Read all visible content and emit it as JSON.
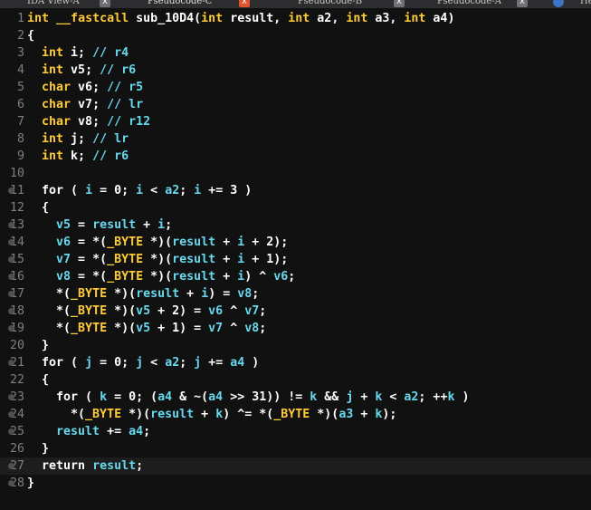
{
  "tabs": [
    {
      "label": "IDA View-A",
      "close": "x",
      "state": "inactive"
    },
    {
      "label": "Pseudocode-C",
      "close": "x",
      "state": "active"
    },
    {
      "label": "Pseudocode-B",
      "close": "x",
      "state": "inactive"
    },
    {
      "label": "Pseudocode-A",
      "close": "x",
      "state": "inactive"
    },
    {
      "label": "He",
      "close": "",
      "state": "inactive"
    }
  ],
  "colors": {
    "background": "#111111",
    "keyword": "#ffcc33",
    "identifier": "#66d9ef",
    "plain": "#ffffff",
    "line_number": "#7f7f7f",
    "tab_close": "#e0522f"
  },
  "code": {
    "current_line": 27,
    "lines": [
      {
        "n": "1",
        "marker": false,
        "tokens": [
          [
            "kw",
            "int"
          ],
          [
            "p",
            " "
          ],
          [
            "kw",
            "__fastcall"
          ],
          [
            "p",
            " sub_10D4("
          ],
          [
            "kw",
            "int"
          ],
          [
            "p",
            " result, "
          ],
          [
            "kw",
            "int"
          ],
          [
            "p",
            " a2, "
          ],
          [
            "kw",
            "int"
          ],
          [
            "p",
            " a3, "
          ],
          [
            "kw",
            "int"
          ],
          [
            "p",
            " a4)"
          ]
        ]
      },
      {
        "n": "2",
        "marker": false,
        "tokens": [
          [
            "p",
            "{"
          ]
        ]
      },
      {
        "n": "3",
        "marker": false,
        "tokens": [
          [
            "p",
            "  "
          ],
          [
            "kw",
            "int"
          ],
          [
            "p",
            " i; "
          ],
          [
            "cm",
            "// r4"
          ]
        ]
      },
      {
        "n": "4",
        "marker": false,
        "tokens": [
          [
            "p",
            "  "
          ],
          [
            "kw",
            "int"
          ],
          [
            "p",
            " v5; "
          ],
          [
            "cm",
            "// r6"
          ]
        ]
      },
      {
        "n": "5",
        "marker": false,
        "tokens": [
          [
            "p",
            "  "
          ],
          [
            "kw",
            "char"
          ],
          [
            "p",
            " v6; "
          ],
          [
            "cm",
            "// r5"
          ]
        ]
      },
      {
        "n": "6",
        "marker": false,
        "tokens": [
          [
            "p",
            "  "
          ],
          [
            "kw",
            "char"
          ],
          [
            "p",
            " v7; "
          ],
          [
            "cm",
            "// lr"
          ]
        ]
      },
      {
        "n": "7",
        "marker": false,
        "tokens": [
          [
            "p",
            "  "
          ],
          [
            "kw",
            "char"
          ],
          [
            "p",
            " v8; "
          ],
          [
            "cm",
            "// r12"
          ]
        ]
      },
      {
        "n": "8",
        "marker": false,
        "tokens": [
          [
            "p",
            "  "
          ],
          [
            "kw",
            "int"
          ],
          [
            "p",
            " j; "
          ],
          [
            "cm",
            "// lr"
          ]
        ]
      },
      {
        "n": "9",
        "marker": false,
        "tokens": [
          [
            "p",
            "  "
          ],
          [
            "kw",
            "int"
          ],
          [
            "p",
            " k; "
          ],
          [
            "cm",
            "// r6"
          ]
        ]
      },
      {
        "n": "10",
        "marker": false,
        "tokens": []
      },
      {
        "n": "11",
        "marker": true,
        "tokens": [
          [
            "p",
            "  "
          ],
          [
            "p",
            "for"
          ],
          [
            "p",
            " ( "
          ],
          [
            "id",
            "i"
          ],
          [
            "p",
            " = 0; "
          ],
          [
            "id",
            "i"
          ],
          [
            "p",
            " < "
          ],
          [
            "id",
            "a2"
          ],
          [
            "p",
            "; "
          ],
          [
            "id",
            "i"
          ],
          [
            "p",
            " += 3 )"
          ]
        ]
      },
      {
        "n": "12",
        "marker": false,
        "tokens": [
          [
            "p",
            "  {"
          ]
        ]
      },
      {
        "n": "13",
        "marker": true,
        "tokens": [
          [
            "p",
            "    "
          ],
          [
            "id",
            "v5"
          ],
          [
            "p",
            " = "
          ],
          [
            "id",
            "result"
          ],
          [
            "p",
            " + "
          ],
          [
            "id",
            "i"
          ],
          [
            "p",
            ";"
          ]
        ]
      },
      {
        "n": "14",
        "marker": true,
        "tokens": [
          [
            "p",
            "    "
          ],
          [
            "id",
            "v6"
          ],
          [
            "p",
            " = *("
          ],
          [
            "kw",
            "_BYTE"
          ],
          [
            "p",
            " *)("
          ],
          [
            "id",
            "result"
          ],
          [
            "p",
            " + "
          ],
          [
            "id",
            "i"
          ],
          [
            "p",
            " + 2);"
          ]
        ]
      },
      {
        "n": "15",
        "marker": true,
        "tokens": [
          [
            "p",
            "    "
          ],
          [
            "id",
            "v7"
          ],
          [
            "p",
            " = *("
          ],
          [
            "kw",
            "_BYTE"
          ],
          [
            "p",
            " *)("
          ],
          [
            "id",
            "result"
          ],
          [
            "p",
            " + "
          ],
          [
            "id",
            "i"
          ],
          [
            "p",
            " + 1);"
          ]
        ]
      },
      {
        "n": "16",
        "marker": true,
        "tokens": [
          [
            "p",
            "    "
          ],
          [
            "id",
            "v8"
          ],
          [
            "p",
            " = *("
          ],
          [
            "kw",
            "_BYTE"
          ],
          [
            "p",
            " *)("
          ],
          [
            "id",
            "result"
          ],
          [
            "p",
            " + "
          ],
          [
            "id",
            "i"
          ],
          [
            "p",
            ") ^ "
          ],
          [
            "id",
            "v6"
          ],
          [
            "p",
            ";"
          ]
        ]
      },
      {
        "n": "17",
        "marker": true,
        "tokens": [
          [
            "p",
            "    *("
          ],
          [
            "kw",
            "_BYTE"
          ],
          [
            "p",
            " *)("
          ],
          [
            "id",
            "result"
          ],
          [
            "p",
            " + "
          ],
          [
            "id",
            "i"
          ],
          [
            "p",
            ") = "
          ],
          [
            "id",
            "v8"
          ],
          [
            "p",
            ";"
          ]
        ]
      },
      {
        "n": "18",
        "marker": true,
        "tokens": [
          [
            "p",
            "    *("
          ],
          [
            "kw",
            "_BYTE"
          ],
          [
            "p",
            " *)("
          ],
          [
            "id",
            "v5"
          ],
          [
            "p",
            " + 2) = "
          ],
          [
            "id",
            "v6"
          ],
          [
            "p",
            " ^ "
          ],
          [
            "id",
            "v7"
          ],
          [
            "p",
            ";"
          ]
        ]
      },
      {
        "n": "19",
        "marker": true,
        "tokens": [
          [
            "p",
            "    *("
          ],
          [
            "kw",
            "_BYTE"
          ],
          [
            "p",
            " *)("
          ],
          [
            "id",
            "v5"
          ],
          [
            "p",
            " + 1) = "
          ],
          [
            "id",
            "v7"
          ],
          [
            "p",
            " ^ "
          ],
          [
            "id",
            "v8"
          ],
          [
            "p",
            ";"
          ]
        ]
      },
      {
        "n": "20",
        "marker": false,
        "tokens": [
          [
            "p",
            "  }"
          ]
        ]
      },
      {
        "n": "21",
        "marker": true,
        "tokens": [
          [
            "p",
            "  "
          ],
          [
            "p",
            "for"
          ],
          [
            "p",
            " ( "
          ],
          [
            "id",
            "j"
          ],
          [
            "p",
            " = 0; "
          ],
          [
            "id",
            "j"
          ],
          [
            "p",
            " < "
          ],
          [
            "id",
            "a2"
          ],
          [
            "p",
            "; "
          ],
          [
            "id",
            "j"
          ],
          [
            "p",
            " += "
          ],
          [
            "id",
            "a4"
          ],
          [
            "p",
            " )"
          ]
        ]
      },
      {
        "n": "22",
        "marker": false,
        "tokens": [
          [
            "p",
            "  {"
          ]
        ]
      },
      {
        "n": "23",
        "marker": true,
        "tokens": [
          [
            "p",
            "    for ( "
          ],
          [
            "id",
            "k"
          ],
          [
            "p",
            " = 0; ("
          ],
          [
            "id",
            "a4"
          ],
          [
            "p",
            " & ~("
          ],
          [
            "id",
            "a4"
          ],
          [
            "p",
            " >> 31)) != "
          ],
          [
            "id",
            "k"
          ],
          [
            "p",
            " && "
          ],
          [
            "id",
            "j"
          ],
          [
            "p",
            " + "
          ],
          [
            "id",
            "k"
          ],
          [
            "p",
            " < "
          ],
          [
            "id",
            "a2"
          ],
          [
            "p",
            "; ++"
          ],
          [
            "id",
            "k"
          ],
          [
            "p",
            " )"
          ]
        ]
      },
      {
        "n": "24",
        "marker": true,
        "tokens": [
          [
            "p",
            "      *("
          ],
          [
            "kw",
            "_BYTE"
          ],
          [
            "p",
            " *)("
          ],
          [
            "id",
            "result"
          ],
          [
            "p",
            " + "
          ],
          [
            "id",
            "k"
          ],
          [
            "p",
            ") ^= *("
          ],
          [
            "kw",
            "_BYTE"
          ],
          [
            "p",
            " *)("
          ],
          [
            "id",
            "a3"
          ],
          [
            "p",
            " + "
          ],
          [
            "id",
            "k"
          ],
          [
            "p",
            ");"
          ]
        ]
      },
      {
        "n": "25",
        "marker": true,
        "tokens": [
          [
            "p",
            "    "
          ],
          [
            "id",
            "result"
          ],
          [
            "p",
            " += "
          ],
          [
            "id",
            "a4"
          ],
          [
            "p",
            ";"
          ]
        ]
      },
      {
        "n": "26",
        "marker": false,
        "tokens": [
          [
            "p",
            "  }"
          ]
        ]
      },
      {
        "n": "27",
        "marker": true,
        "tokens": [
          [
            "p",
            "  "
          ],
          [
            "p",
            "return"
          ],
          [
            "p",
            " "
          ],
          [
            "id",
            "result"
          ],
          [
            "p",
            ";"
          ]
        ]
      },
      {
        "n": "28",
        "marker": true,
        "tokens": [
          [
            "p",
            "}"
          ]
        ]
      }
    ]
  }
}
